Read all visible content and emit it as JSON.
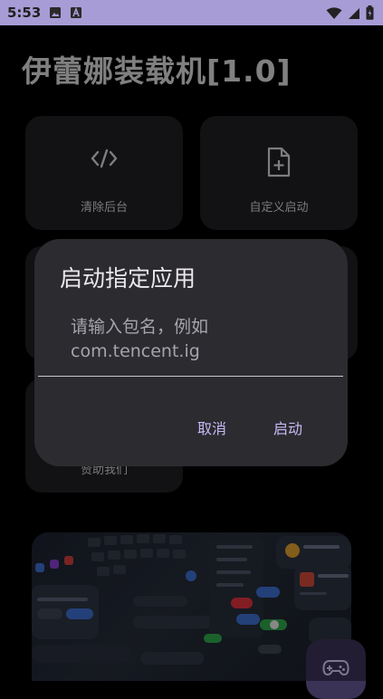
{
  "status_bar": {
    "time": "5:53",
    "icons": [
      "image-icon",
      "a-icon",
      "wifi-icon",
      "signal-icon",
      "battery-icon"
    ]
  },
  "app": {
    "title": "伊蕾娜装载机[1.0]",
    "tiles": [
      {
        "label": "清除后台",
        "icon": "code-icon"
      },
      {
        "label": "自定义启动",
        "icon": "file-add-icon"
      },
      {
        "label": "赞助我们"
      }
    ],
    "fab_icon": "gamepad-icon"
  },
  "dialog": {
    "title": "启动指定应用",
    "input_value": "",
    "input_placeholder": "请输入包名，例如\ncom.tencent.ig",
    "cancel_label": "取消",
    "confirm_label": "启动"
  },
  "colors": {
    "status_bar": "#a89cd6",
    "background": "#000000",
    "tile": "#1f1e21",
    "dialog": "#2c2b30",
    "accent": "#c7b9f5",
    "fab": "#3b3356"
  }
}
